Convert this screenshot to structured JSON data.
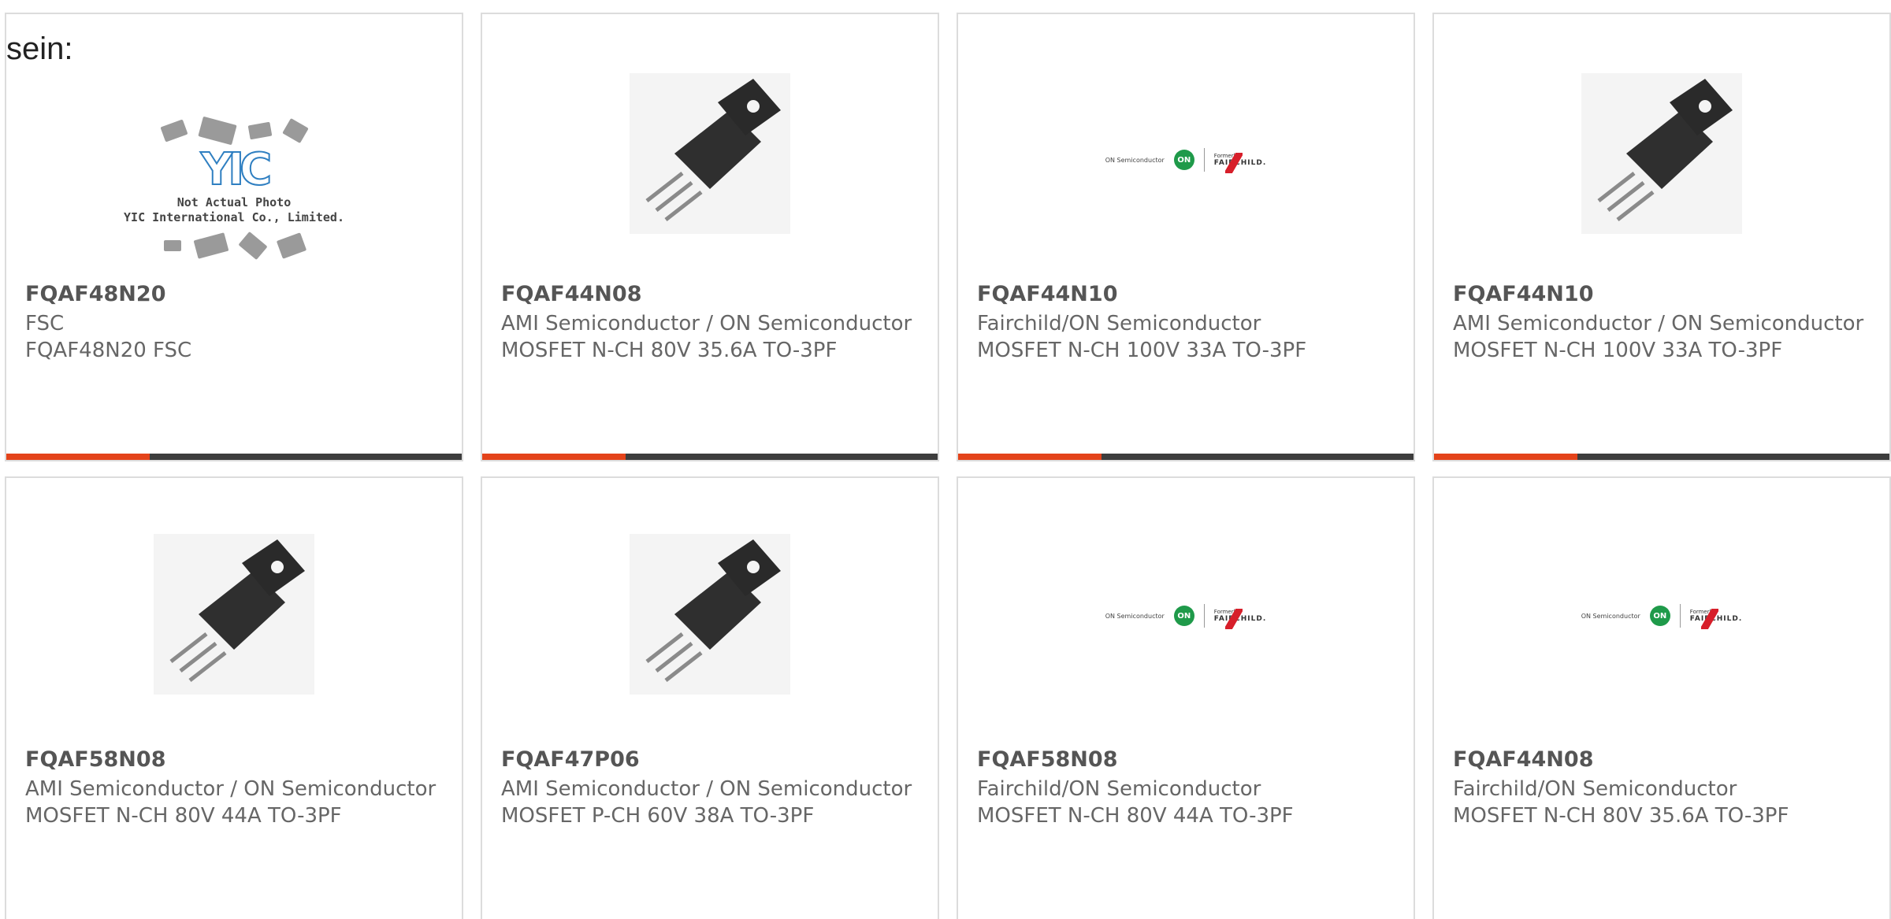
{
  "intro": "sein:",
  "accent_color": "#e4431a",
  "bar_color": "#3d3d3d",
  "products": [
    {
      "part": "FQAF48N20",
      "manufacturer": "FSC",
      "description": "FQAF48N20 FSC",
      "image": "yic-not-actual-photo",
      "placeholder": {
        "logo": "YIC",
        "line1": "Not Actual Photo",
        "line2": "YIC International Co., Limited."
      }
    },
    {
      "part": "FQAF44N08",
      "manufacturer": "AMI Semiconductor / ON Semiconductor",
      "description": "MOSFET N-CH 80V 35.6A TO-3PF",
      "image": "transistor-photo"
    },
    {
      "part": "FQAF44N10",
      "manufacturer": "Fairchild/ON Semiconductor",
      "description": "MOSFET N-CH 100V 33A TO-3PF",
      "image": "on-fairchild-logo"
    },
    {
      "part": "FQAF44N10",
      "manufacturer": "AMI Semiconductor / ON Semiconductor",
      "description": "MOSFET N-CH 100V 33A TO-3PF",
      "image": "transistor-photo"
    },
    {
      "part": "FQAF58N08",
      "manufacturer": "AMI Semiconductor / ON Semiconductor",
      "description": "MOSFET N-CH 80V 44A TO-3PF",
      "image": "transistor-photo"
    },
    {
      "part": "FQAF47P06",
      "manufacturer": "AMI Semiconductor / ON Semiconductor",
      "description": "MOSFET P-CH 60V 38A TO-3PF",
      "image": "transistor-photo"
    },
    {
      "part": "FQAF58N08",
      "manufacturer": "Fairchild/ON Semiconductor",
      "description": "MOSFET N-CH 80V 44A TO-3PF",
      "image": "on-fairchild-logo"
    },
    {
      "part": "FQAF44N08",
      "manufacturer": "Fairchild/ON Semiconductor",
      "description": "MOSFET N-CH 80V 35.6A TO-3PF",
      "image": "on-fairchild-logo"
    }
  ],
  "logo": {
    "on_label": "ON Semiconductor",
    "on_mark": "ON",
    "formerly": "Formerly",
    "fairchild": "FAIRCHILD."
  }
}
